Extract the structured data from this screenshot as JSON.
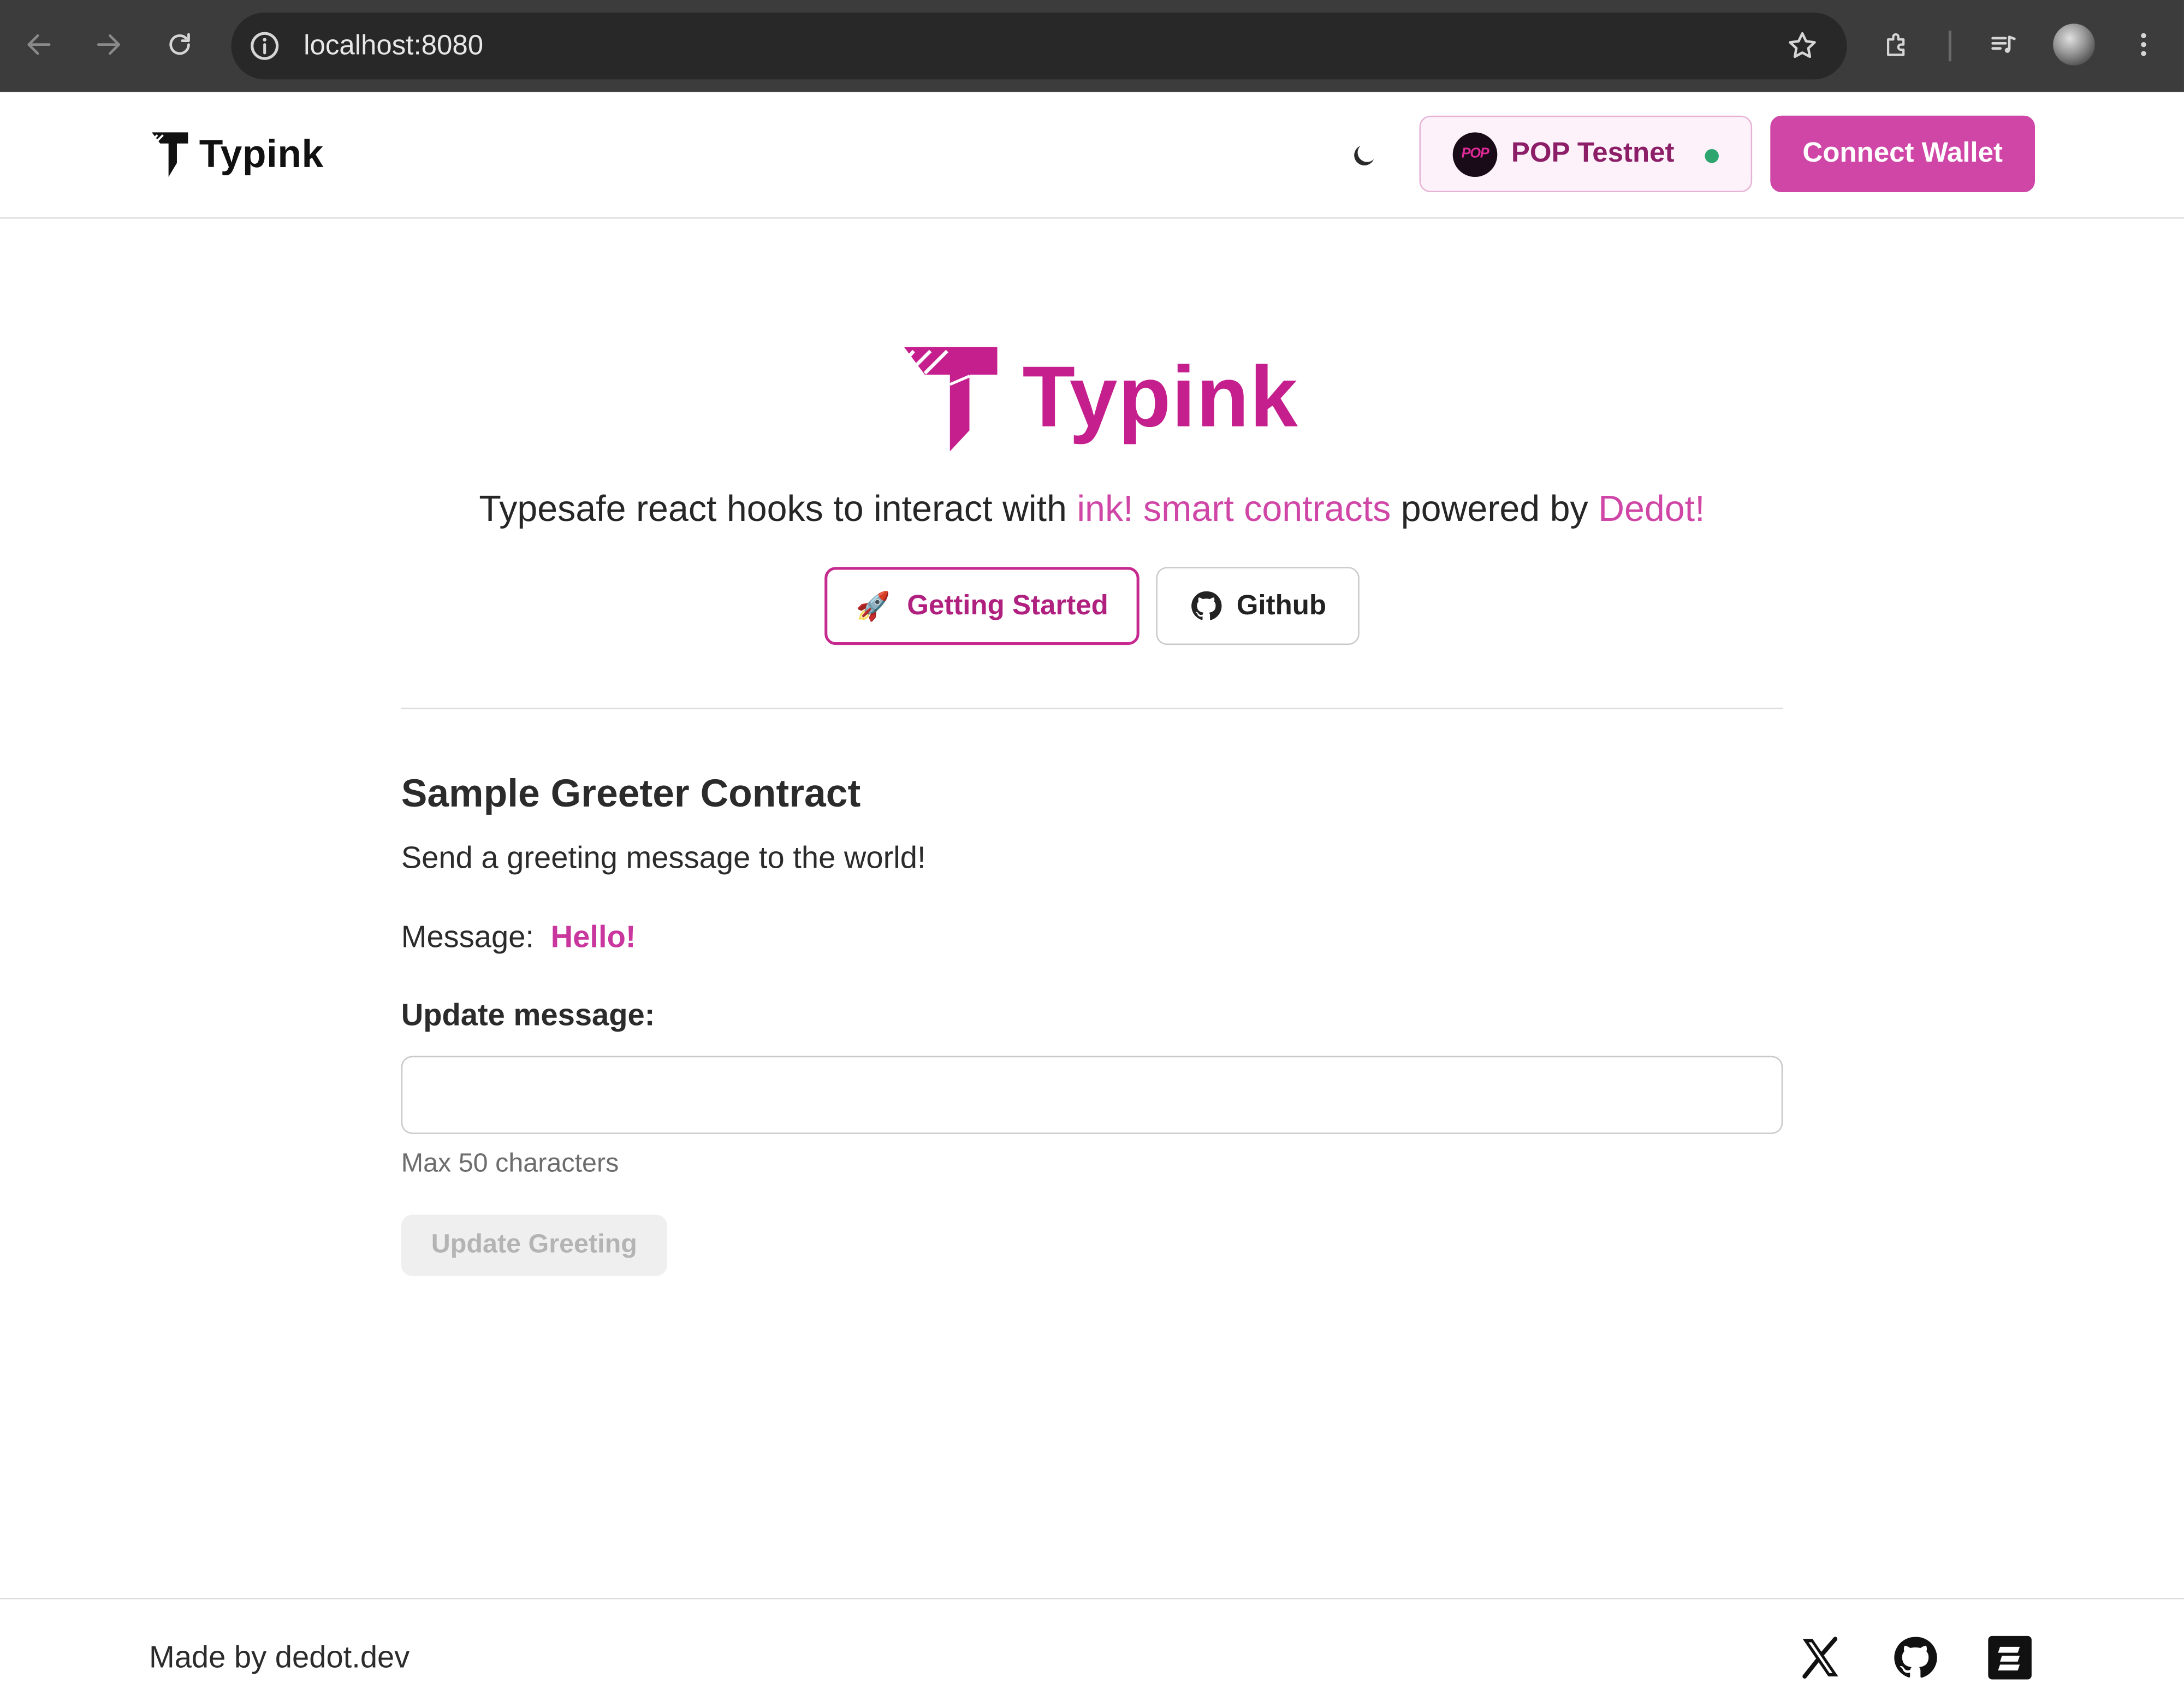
{
  "browser": {
    "url": "localhost:8080",
    "icons": [
      "back-arrow-icon",
      "forward-arrow-icon",
      "reload-icon",
      "info-icon",
      "star-icon",
      "extensions-icon",
      "media-icon",
      "profile-avatar",
      "more-icon"
    ]
  },
  "header": {
    "brand": "Typink",
    "network": {
      "name": "POP Testnet",
      "logo_text": "POP",
      "status_color": "#2ea56f"
    },
    "connect_label": "Connect Wallet"
  },
  "hero": {
    "title": "Typink",
    "tagline": {
      "prefix": "Typesafe react hooks to interact with ",
      "link1": "ink! smart contracts",
      "middle": " powered by ",
      "link2": "Dedot!"
    },
    "getting_started_emoji": "🚀",
    "getting_started_label": "Getting Started",
    "github_label": "Github"
  },
  "contract": {
    "title": "Sample Greeter Contract",
    "description": "Send a greeting message to the world!",
    "message_label": "Message:",
    "message_value": "Hello!",
    "update_label": "Update message:",
    "input_value": "",
    "input_placeholder": "",
    "helper": "Max 50 characters",
    "update_button": "Update Greeting"
  },
  "footer": {
    "made_by": "Made by dedot.dev",
    "icons": [
      "x-icon",
      "github-icon",
      "dedot-icon"
    ]
  },
  "colors": {
    "brand_pink": "#c51f8e",
    "accent": "#cf46a6",
    "status_green": "#2ea56f"
  }
}
